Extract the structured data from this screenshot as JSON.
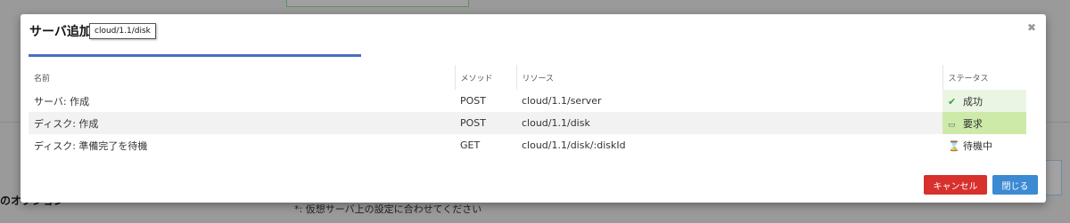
{
  "background": {
    "left_text": "のオプション",
    "note": "*: 仮想サーバ上の設定に合わせてください"
  },
  "modal": {
    "title": "サーバ追加",
    "tooltip": "cloud/1.1/disk",
    "progress": 0.33,
    "columns": {
      "name": "名前",
      "method": "メソッド",
      "resource": "リソース",
      "status": "ステータス"
    },
    "rows": [
      {
        "name": "サーバ: 作成",
        "method": "POST",
        "resource": "cloud/1.1/server",
        "status": "成功",
        "status_icon": "checkmark-icon",
        "status_color": "#ebf5e3"
      },
      {
        "name": "ディスク: 作成",
        "method": "POST",
        "resource": "cloud/1.1/disk",
        "status": "要求",
        "status_icon": "progress-dots-icon",
        "status_color": "#cdeaa8"
      },
      {
        "name": "ディスク: 準備完了を待機",
        "method": "GET",
        "resource": "cloud/1.1/disk/:diskId",
        "status": "待機中",
        "status_icon": "hourglass-icon",
        "status_color": "#ffffff"
      }
    ],
    "buttons": {
      "cancel": "キャンセル",
      "close": "閉じる"
    }
  },
  "colors": {
    "accent": "#4a6ec4",
    "cancel": "#d7302d",
    "close": "#3b8ad2"
  }
}
